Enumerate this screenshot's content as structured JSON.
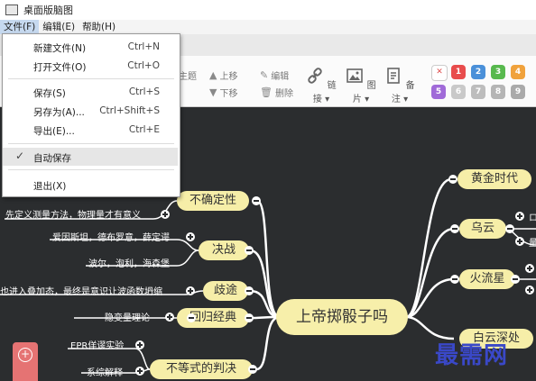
{
  "window": {
    "title": "桌面版脑图"
  },
  "menubar": [
    {
      "label": "文件(F)"
    },
    {
      "label": "编辑(E)"
    },
    {
      "label": "帮助(H)"
    }
  ],
  "file_menu": {
    "items": [
      {
        "label": "新建文件(N)",
        "shortcut": "Ctrl+N"
      },
      {
        "label": "打开文件(O)",
        "shortcut": "Ctrl+O"
      },
      {
        "label": "保存(S)",
        "shortcut": "Ctrl+S"
      },
      {
        "label": "另存为(A)...",
        "shortcut": "Ctrl+Shift+S"
      },
      {
        "label": "导出(E)...",
        "shortcut": "Ctrl+E"
      },
      {
        "label": "自动保存",
        "shortcut": "",
        "checked": true
      },
      {
        "label": "退出(X)",
        "shortcut": ""
      }
    ]
  },
  "toolbar": {
    "partial_topic": "主题",
    "move_up": "上移",
    "move_down": "下移",
    "edit": "编辑",
    "delete": "删除",
    "link": "链接",
    "image": "图片",
    "note": "备注",
    "priorities_row1": [
      "1",
      "2",
      "3",
      "4"
    ],
    "priorities_row2": [
      "5",
      "6",
      "7",
      "8",
      "9"
    ],
    "priority_colors": [
      "#ff6b6b",
      "#e84c4c",
      "#4a90d9",
      "#58b94e",
      "#f0a23c"
    ],
    "priority_colors_row2": [
      "#a06ad8",
      "#c9c9c9",
      "#bdbdbd",
      "#b5b5b5",
      "#aaaaaa"
    ]
  },
  "mindmap": {
    "center": "上帝掷骰子吗",
    "left_nodes": [
      {
        "label": "不确定性",
        "leaves": [
          "先定义测量方法，物理量才有意义"
        ]
      },
      {
        "label": "决战",
        "leaves": [
          "爱因斯坦，德布罗意，薛定谔",
          "波尔，泡利，海森堡"
        ]
      },
      {
        "label": "歧途",
        "leaves": [
          "也进入叠加态，最终是意识让波函数坍缩"
        ]
      },
      {
        "label": "回归经典",
        "leaves": [
          "隐变量理论"
        ]
      },
      {
        "label": "不等式的判决",
        "leaves": [
          "EPR佯谬实验",
          "系综解释"
        ]
      }
    ],
    "right_nodes": [
      {
        "label": "黄金时代"
      },
      {
        "label": "乌云",
        "partial_leaves": [
          "ロ",
          "量"
        ]
      },
      {
        "label": "火流星"
      },
      {
        "label": "白云深处"
      }
    ]
  },
  "watermark": "最需网"
}
